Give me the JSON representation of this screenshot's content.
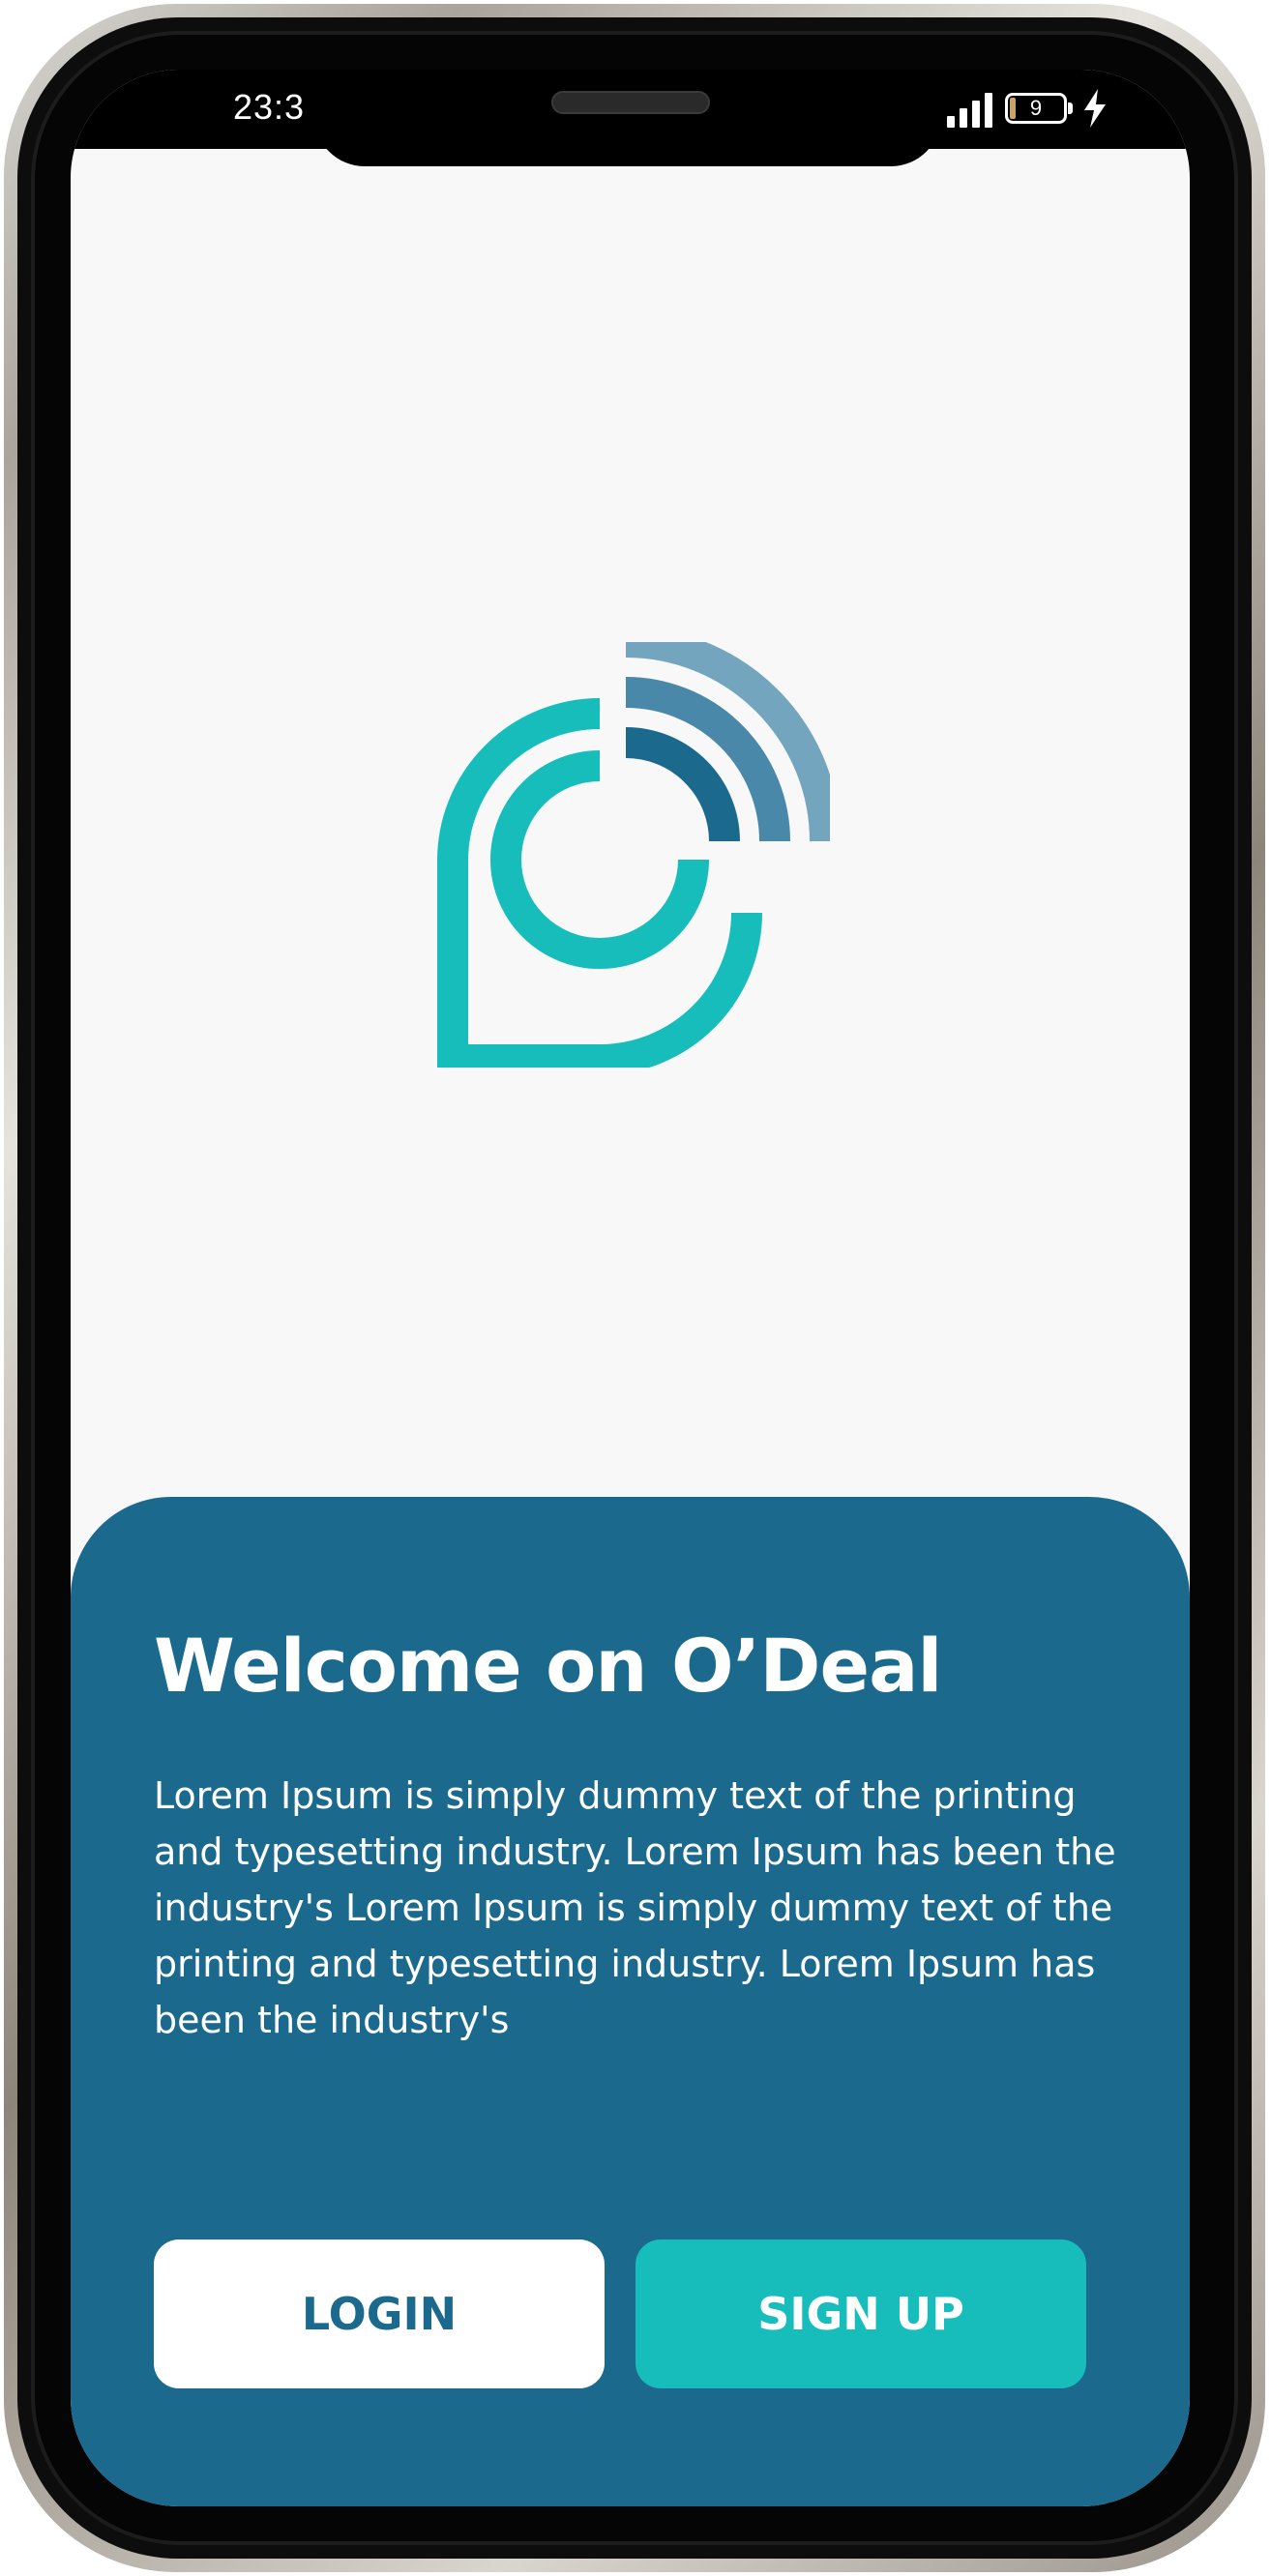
{
  "status_bar": {
    "time": "23:3",
    "battery_level": "9"
  },
  "app": {
    "logo_icon": "odeal-logo-icon",
    "colors": {
      "brand_dark": "#1b6a8e",
      "brand_teal": "#17bdbb",
      "arc_light": "#73a6be",
      "arc_mid": "#4988a8"
    }
  },
  "welcome": {
    "title": "Welcome on O’Deal",
    "description": "Lorem Ipsum is simply dummy text of the printing and typesetting industry. Lorem Ipsum has been the industry's Lorem Ipsum is simply dummy text of the printing and typesetting industry. Lorem Ipsum has been the industry's"
  },
  "actions": {
    "login_label": "LOGIN",
    "signup_label": "SIGN UP"
  }
}
